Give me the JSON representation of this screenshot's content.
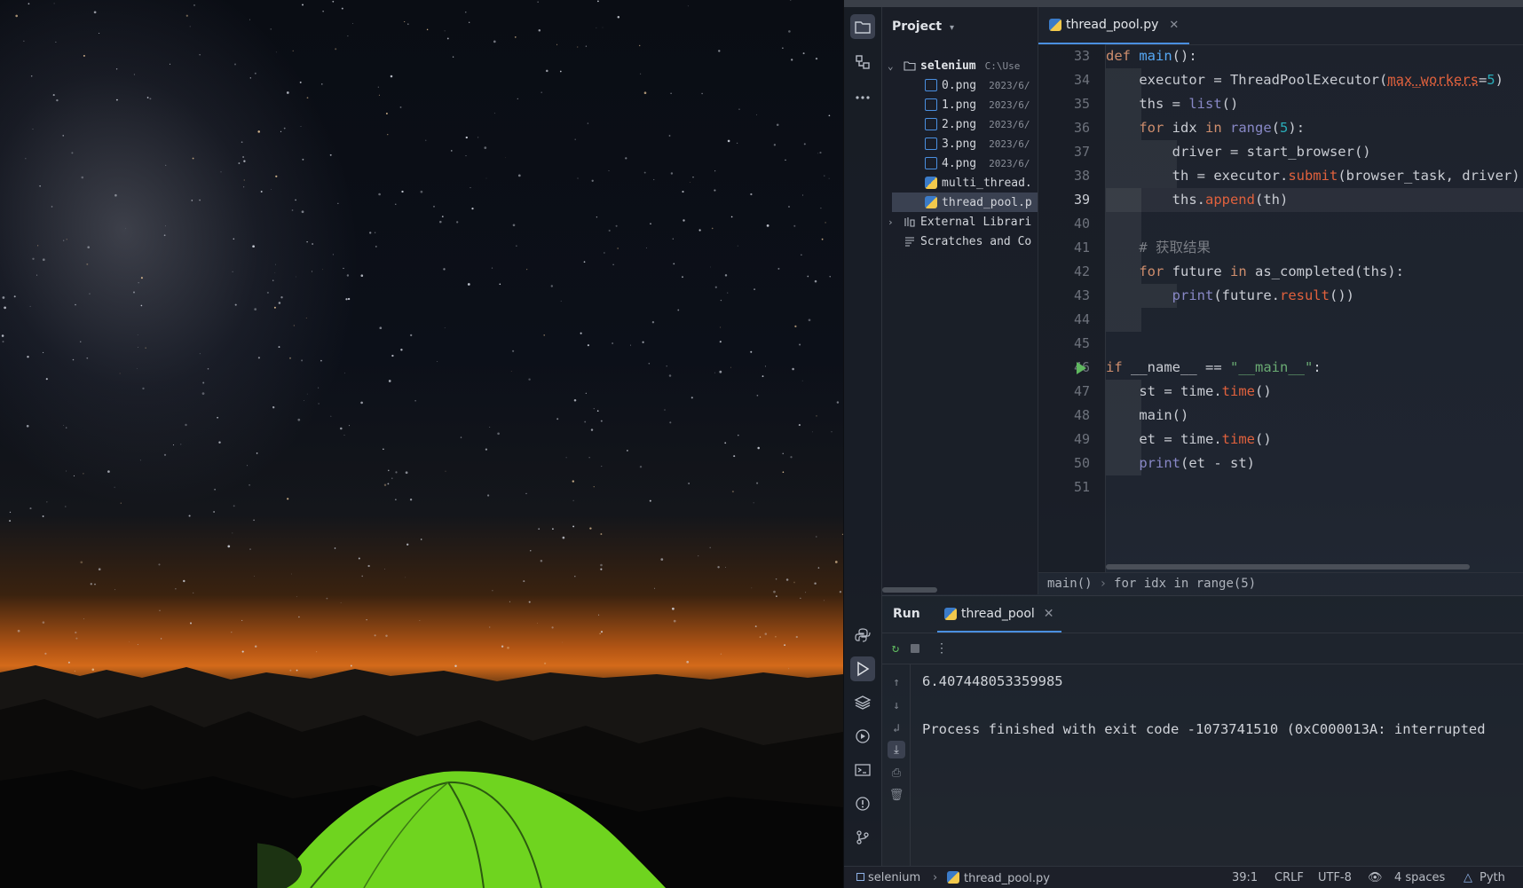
{
  "wallpaper": {
    "description_icon": "starry-sky-tent-wallpaper"
  },
  "ide": {
    "left_toolbar": {
      "top_icons": [
        "folder-icon",
        "structure-icon",
        "more-icon"
      ],
      "bottom_icons": [
        "python-console-icon",
        "run-icon",
        "layers-icon",
        "services-icon",
        "terminal-icon",
        "problems-icon",
        "git-icon"
      ]
    },
    "project": {
      "header": "Project",
      "root": {
        "name": "selenium",
        "meta": "C:\\Use"
      },
      "files": [
        {
          "name": "0.png",
          "meta": "2023/6/",
          "type": "png"
        },
        {
          "name": "1.png",
          "meta": "2023/6/",
          "type": "png"
        },
        {
          "name": "2.png",
          "meta": "2023/6/",
          "type": "png"
        },
        {
          "name": "3.png",
          "meta": "2023/6/",
          "type": "png"
        },
        {
          "name": "4.png",
          "meta": "2023/6/",
          "type": "png"
        },
        {
          "name": "multi_thread.",
          "meta": "",
          "type": "py"
        },
        {
          "name": "thread_pool.p",
          "meta": "",
          "type": "py"
        }
      ],
      "external": "External Librari",
      "scratches": "Scratches and Co"
    },
    "editor": {
      "tab": "thread_pool.py",
      "line_numbers": [
        "33",
        "34",
        "35",
        "36",
        "37",
        "38",
        "39",
        "40",
        "41",
        "42",
        "43",
        "44",
        "45",
        "46",
        "47",
        "48",
        "49",
        "50",
        "51"
      ],
      "current_line": "39",
      "breadcrumb": [
        "main()",
        "for idx in range(5)"
      ]
    },
    "run": {
      "title": "Run",
      "tab": "thread_pool",
      "output": [
        "6.407448053359985",
        "",
        "Process finished with exit code -1073741510 (0xC000013A: interrupted"
      ]
    },
    "status": {
      "path_root": "selenium",
      "path_file": "thread_pool.py",
      "position": "39:1",
      "line_sep": "CRLF",
      "encoding": "UTF-8",
      "indent": "4 spaces",
      "interpreter": "Pyth"
    },
    "colors": {
      "accent": "#4a8fe0",
      "keyword": "#cf8e6d",
      "function": "#56a8f5",
      "string": "#6aab73",
      "number": "#2aacb8"
    }
  }
}
